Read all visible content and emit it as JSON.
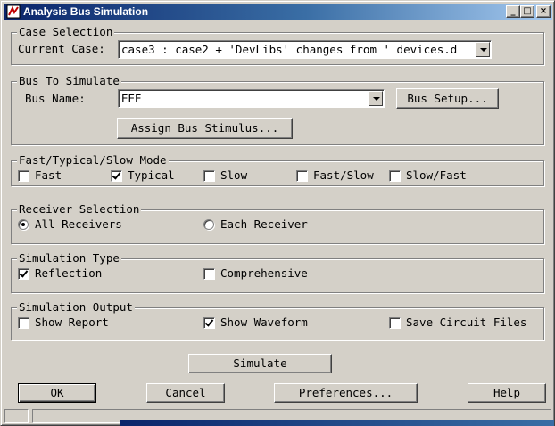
{
  "window": {
    "title": "Analysis Bus Simulation"
  },
  "title_buttons": {
    "minimize": "_",
    "restore": "□",
    "close": "×"
  },
  "case_selection": {
    "legend": "Case Selection",
    "current_case_label": "Current Case:",
    "current_case_value": "case3 : case2 + 'DevLibs' changes from ' devices.d"
  },
  "bus": {
    "legend": "Bus To Simulate",
    "bus_name_label": "Bus Name:",
    "bus_name_value": "EEE",
    "bus_setup_button": "Bus Setup...",
    "assign_button": "Assign Bus Stimulus..."
  },
  "mode": {
    "legend": "Fast/Typical/Slow Mode",
    "options": [
      {
        "label": "Fast",
        "checked": false
      },
      {
        "label": "Typical",
        "checked": true
      },
      {
        "label": "Slow",
        "checked": false
      },
      {
        "label": "Fast/Slow",
        "checked": false
      },
      {
        "label": "Slow/Fast",
        "checked": false
      }
    ]
  },
  "receiver": {
    "legend": "Receiver Selection",
    "options": [
      {
        "label": "All Receivers",
        "selected": true
      },
      {
        "label": "Each Receiver",
        "selected": false
      }
    ]
  },
  "sim_type": {
    "legend": "Simulation Type",
    "options": [
      {
        "label": "Reflection",
        "checked": true
      },
      {
        "label": "Comprehensive",
        "checked": false
      }
    ]
  },
  "sim_output": {
    "legend": "Simulation Output",
    "options": [
      {
        "label": "Show Report",
        "checked": false
      },
      {
        "label": "Show Waveform",
        "checked": true
      },
      {
        "label": "Save Circuit Files",
        "checked": false
      }
    ]
  },
  "buttons": {
    "simulate": "Simulate",
    "ok": "OK",
    "cancel": "Cancel",
    "preferences": "Preferences...",
    "help": "Help"
  },
  "colors": {
    "face": "#d4d0c8",
    "title_start": "#0a246a",
    "title_end": "#a6caf0"
  }
}
